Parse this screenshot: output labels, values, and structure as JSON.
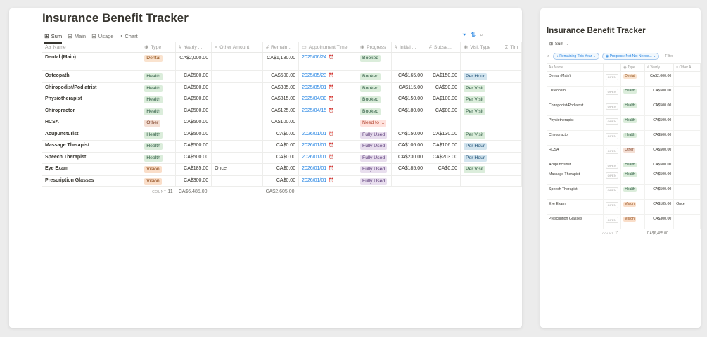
{
  "main": {
    "title": "Insurance Benefit Tracker",
    "views": [
      {
        "icon": "table-icon",
        "label": "Sum",
        "active": true
      },
      {
        "icon": "table-icon",
        "label": "Main",
        "active": false
      },
      {
        "icon": "table-icon",
        "label": "Usage",
        "active": false
      },
      {
        "icon": "pie-chart-icon",
        "label": "Chart",
        "active": false
      }
    ],
    "columns": [
      {
        "icon": "Aa",
        "label": "Name"
      },
      {
        "icon": "◉",
        "label": "Type"
      },
      {
        "icon": "#",
        "label": "Yearly ..."
      },
      {
        "icon": "≡",
        "label": "Other Amount"
      },
      {
        "icon": "#",
        "label": "Remain..."
      },
      {
        "icon": "▭",
        "label": "Appointment Time"
      },
      {
        "icon": "◉",
        "label": "Progress"
      },
      {
        "icon": "#",
        "label": "Initial ..."
      },
      {
        "icon": "#",
        "label": "Subse..."
      },
      {
        "icon": "◉",
        "label": "Visit Type"
      },
      {
        "icon": "Σ",
        "label": "Tim"
      }
    ],
    "rows": [
      {
        "name": "Dental (Main)",
        "type": "Dental",
        "yearly": "CA$2,000.00",
        "other": "",
        "remaining": "CA$1,180.00",
        "appointment": "2025/06/24",
        "progress": "Booked",
        "initial": "",
        "subsequent": "",
        "visit_type": ""
      },
      {
        "name": "Osteopath",
        "type": "Health",
        "yearly": "CA$500.00",
        "other": "",
        "remaining": "CA$500.00",
        "appointment": "2025/05/23",
        "progress": "Booked",
        "initial": "CA$165.00",
        "subsequent": "CA$150.00",
        "visit_type": "Per Hour"
      },
      {
        "name": "Chiropodist/Podiatrist",
        "type": "Health",
        "yearly": "CA$500.00",
        "other": "",
        "remaining": "CA$385.00",
        "appointment": "2025/05/01",
        "progress": "Booked",
        "initial": "CA$115.00",
        "subsequent": "CA$90.00",
        "visit_type": "Per Visit"
      },
      {
        "name": "Physiotherapist",
        "type": "Health",
        "yearly": "CA$500.00",
        "other": "",
        "remaining": "CA$315.00",
        "appointment": "2025/04/30",
        "progress": "Booked",
        "initial": "CA$150.00",
        "subsequent": "CA$100.00",
        "visit_type": "Per Visit"
      },
      {
        "name": "Chiropractor",
        "type": "Health",
        "yearly": "CA$500.00",
        "other": "",
        "remaining": "CA$125.00",
        "appointment": "2025/04/15",
        "progress": "Booked",
        "initial": "CA$180.00",
        "subsequent": "CA$80.00",
        "visit_type": "Per Visit"
      },
      {
        "name": "HCSA",
        "type": "Other",
        "yearly": "CA$500.00",
        "other": "",
        "remaining": "CA$100.00",
        "appointment": "",
        "progress": "Need to ...",
        "initial": "",
        "subsequent": "",
        "visit_type": ""
      },
      {
        "name": "Acupuncturist",
        "type": "Health",
        "yearly": "CA$500.00",
        "other": "",
        "remaining": "CA$0.00",
        "appointment": "2026/01/01",
        "progress": "Fully Used",
        "initial": "CA$150.00",
        "subsequent": "CA$130.00",
        "visit_type": "Per Visit"
      },
      {
        "name": "Massage Therapist",
        "type": "Health",
        "yearly": "CA$500.00",
        "other": "",
        "remaining": "CA$0.00",
        "appointment": "2026/01/01",
        "progress": "Fully Used",
        "initial": "CA$106.00",
        "subsequent": "CA$106.00",
        "visit_type": "Per Hour"
      },
      {
        "name": "Speech Therapist",
        "type": "Health",
        "yearly": "CA$500.00",
        "other": "",
        "remaining": "CA$0.00",
        "appointment": "2026/01/01",
        "progress": "Fully Used",
        "initial": "CA$230.00",
        "subsequent": "CA$203.00",
        "visit_type": "Per Hour"
      },
      {
        "name": "Eye Exam",
        "type": "Vision",
        "yearly": "CA$185.00",
        "other": "Once",
        "remaining": "CA$0.00",
        "appointment": "2026/01/01",
        "progress": "Fully Used",
        "initial": "CA$185.00",
        "subsequent": "CA$0.00",
        "visit_type": "Per Visit"
      },
      {
        "name": "Prescription Glasses",
        "type": "Vision",
        "yearly": "CA$300.00",
        "other": "",
        "remaining": "CA$0.00",
        "appointment": "2026/01/01",
        "progress": "Fully Used",
        "initial": "",
        "subsequent": "",
        "visit_type": ""
      }
    ],
    "summary": {
      "count_label": "COUNT",
      "count": "11",
      "yearly_total": "CA$6,485.00",
      "remaining_total": "CA$2,605.00"
    }
  },
  "side": {
    "title": "Insurance Benefit Tracker",
    "view_label": "Sum",
    "filters": [
      "Remaining This Year",
      "Progress: Not Not Neede..."
    ],
    "add_filter": "+ Filter",
    "columns": [
      "Aa Name",
      "",
      "◉ Type",
      "# Yearly ...",
      "≡ Other A"
    ],
    "open_label": "OPEN",
    "rows": [
      {
        "name": "Dental (Main)",
        "type": "Dental",
        "yearly": "CA$2,000.00",
        "other": ""
      },
      {
        "name": "Osteopath",
        "type": "Health",
        "yearly": "CA$500.00",
        "other": ""
      },
      {
        "name": "Chiropodist/Podiatrist",
        "type": "Health",
        "yearly": "CA$500.00",
        "other": ""
      },
      {
        "name": "Physiotherapist",
        "type": "Health",
        "yearly": "CA$500.00",
        "other": ""
      },
      {
        "name": "Chiropractor",
        "type": "Health",
        "yearly": "CA$500.00",
        "other": ""
      },
      {
        "name": "HCSA",
        "type": "Other",
        "yearly": "CA$500.00",
        "other": ""
      },
      {
        "name": "Acupuncturist",
        "type": "Health",
        "yearly": "CA$500.00",
        "other": ""
      },
      {
        "name": "Massage Therapist",
        "type": "Health",
        "yearly": "CA$500.00",
        "other": ""
      },
      {
        "name": "Speech Therapist",
        "type": "Health",
        "yearly": "CA$500.00",
        "other": ""
      },
      {
        "name": "Eye Exam",
        "type": "Vision",
        "yearly": "CA$185.00",
        "other": "Once"
      },
      {
        "name": "Prescription Glasses",
        "type": "Vision",
        "yearly": "CA$300.00",
        "other": ""
      }
    ],
    "summary": {
      "count_label": "COUNT",
      "count": "11",
      "yearly_total": "CA$6,485.00"
    }
  },
  "tag_colors": {
    "Dental": {
      "bg": "#fae3cf",
      "fg": "#8a4a12"
    },
    "Health": {
      "bg": "#dbeddb",
      "fg": "#2b593f"
    },
    "Other": {
      "bg": "#f4dfd4",
      "fg": "#7a3a20"
    },
    "Vision": {
      "bg": "#fadec9",
      "fg": "#8a4413"
    },
    "Booked": {
      "bg": "#dbeddb",
      "fg": "#2b593f"
    },
    "Need to ...": {
      "bg": "#ffe2dd",
      "fg": "#b0402c"
    },
    "Fully Used": {
      "bg": "#e8deee",
      "fg": "#5a3a78"
    },
    "Per Hour": {
      "bg": "#d3e5ef",
      "fg": "#1d4f74"
    },
    "Per Visit": {
      "bg": "#dbeddb",
      "fg": "#2b593f"
    }
  },
  "accent_color": "#2383e2"
}
